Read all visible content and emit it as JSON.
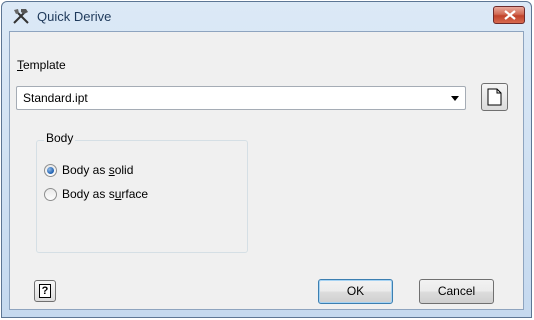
{
  "window": {
    "title": "Quick Derive"
  },
  "template": {
    "label_underline": "T",
    "label_rest": "emplate",
    "value": "Standard.ipt"
  },
  "body_group": {
    "title": "Body",
    "options": [
      {
        "pre": "Body as ",
        "underline": "s",
        "post": "olid",
        "selected": true
      },
      {
        "pre": "Body as s",
        "underline": "u",
        "post": "rface",
        "selected": false
      }
    ]
  },
  "buttons": {
    "help": "?",
    "ok": "OK",
    "cancel": "Cancel"
  },
  "colors": {
    "title_text": "#1e395b",
    "close_button": "#c0432b",
    "client_bg": "#f0f0f0"
  },
  "icons": {
    "app": "derive-tools-icon",
    "close": "close-icon",
    "new_template": "new-document-icon",
    "help": "help-icon"
  }
}
